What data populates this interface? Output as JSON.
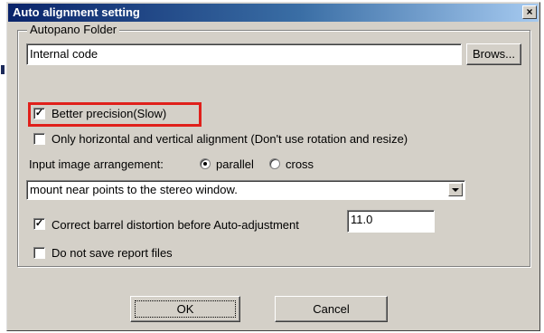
{
  "window": {
    "title": "Auto alignment setting",
    "close_glyph": "×"
  },
  "group": {
    "title": "Autopano Folder"
  },
  "folder": {
    "value": "Internal code",
    "browse_label": "Brows..."
  },
  "better_precision": {
    "label": "Better precision(Slow)",
    "checked": true
  },
  "hv_only": {
    "label": "Only horizontal and vertical alignment (Don't use rotation and resize)",
    "checked": false
  },
  "arrangement": {
    "label": "Input image arrangement:",
    "options": [
      {
        "label": "parallel",
        "selected": true
      },
      {
        "label": "cross",
        "selected": false
      }
    ]
  },
  "mount": {
    "value": "mount near points to the stereo window."
  },
  "barrel": {
    "label": "Correct barrel distortion before Auto-adjustment",
    "checked": true,
    "value": "11.0"
  },
  "no_report": {
    "label": "Do not save report files",
    "checked": false
  },
  "buttons": {
    "ok": "OK",
    "cancel": "Cancel"
  },
  "colors": {
    "title_bar": "#0a246a",
    "dialog_bg": "#d4d0c8",
    "highlight": "#e0201b"
  }
}
